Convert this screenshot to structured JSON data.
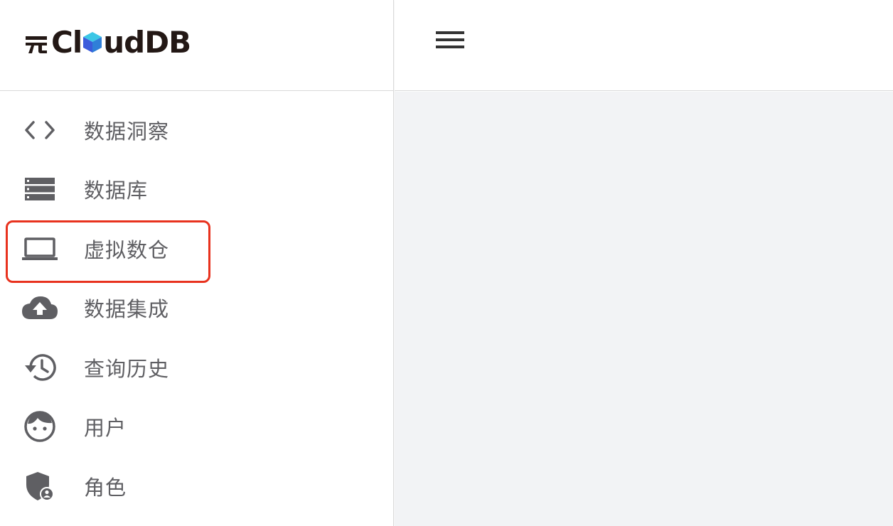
{
  "brand": {
    "logo_text": "CloudDB",
    "logo_alt": "兀CloudDB"
  },
  "colors": {
    "icon": "#5f5f63",
    "label": "#5f5f63",
    "highlight_border": "#e8321e",
    "content_bg": "#f2f3f5"
  },
  "sidebar": {
    "items": [
      {
        "label": "数据洞察",
        "icon": "code-icon"
      },
      {
        "label": "数据库",
        "icon": "database-icon"
      },
      {
        "label": "虚拟数仓",
        "icon": "laptop-icon",
        "highlighted": true
      },
      {
        "label": "数据集成",
        "icon": "cloud-upload-icon"
      },
      {
        "label": "查询历史",
        "icon": "history-icon"
      },
      {
        "label": "用户",
        "icon": "user-face-icon"
      },
      {
        "label": "角色",
        "icon": "role-shield-icon"
      }
    ]
  },
  "topbar": {
    "menu_icon": "hamburger-menu-icon"
  }
}
